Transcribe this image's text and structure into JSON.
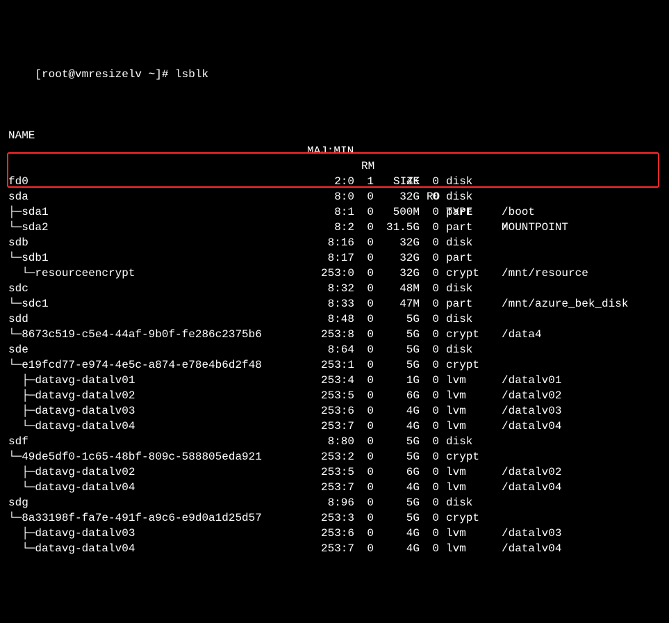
{
  "prompt": "[root@vmresizelv ~]# lsblk",
  "headers": {
    "name": "NAME",
    "majmin": "MAJ:MIN",
    "rm": "RM",
    "size": "SIZE",
    "ro": "RO",
    "type": "TYPE",
    "mount": "MOUNTPOINT"
  },
  "rows": [
    {
      "name": "fd0",
      "majmin": "2:0",
      "rm": "1",
      "size": "4K",
      "ro": "0",
      "type": "disk",
      "mount": ""
    },
    {
      "name": "sda",
      "majmin": "8:0",
      "rm": "0",
      "size": "32G",
      "ro": "0",
      "type": "disk",
      "mount": ""
    },
    {
      "name": "├─sda1",
      "majmin": "8:1",
      "rm": "0",
      "size": "500M",
      "ro": "0",
      "type": "part",
      "mount": "/boot"
    },
    {
      "name": "└─sda2",
      "majmin": "8:2",
      "rm": "0",
      "size": "31.5G",
      "ro": "0",
      "type": "part",
      "mount": "/"
    },
    {
      "name": "sdb",
      "majmin": "8:16",
      "rm": "0",
      "size": "32G",
      "ro": "0",
      "type": "disk",
      "mount": ""
    },
    {
      "name": "└─sdb1",
      "majmin": "8:17",
      "rm": "0",
      "size": "32G",
      "ro": "0",
      "type": "part",
      "mount": ""
    },
    {
      "name": "  └─resourceencrypt",
      "majmin": "253:0",
      "rm": "0",
      "size": "32G",
      "ro": "0",
      "type": "crypt",
      "mount": "/mnt/resource"
    },
    {
      "name": "sdc",
      "majmin": "8:32",
      "rm": "0",
      "size": "48M",
      "ro": "0",
      "type": "disk",
      "mount": ""
    },
    {
      "name": "└─sdc1",
      "majmin": "8:33",
      "rm": "0",
      "size": "47M",
      "ro": "0",
      "type": "part",
      "mount": "/mnt/azure_bek_disk"
    },
    {
      "name": "sdd",
      "majmin": "8:48",
      "rm": "0",
      "size": "5G",
      "ro": "0",
      "type": "disk",
      "mount": ""
    },
    {
      "name": "└─8673c519-c5e4-44af-9b0f-fe286c2375b6",
      "majmin": "253:8",
      "rm": "0",
      "size": "5G",
      "ro": "0",
      "type": "crypt",
      "mount": "/data4"
    },
    {
      "name": "sde",
      "majmin": "8:64",
      "rm": "0",
      "size": "5G",
      "ro": "0",
      "type": "disk",
      "mount": ""
    },
    {
      "name": "└─e19fcd77-e974-4e5c-a874-e78e4b6d2f48",
      "majmin": "253:1",
      "rm": "0",
      "size": "5G",
      "ro": "0",
      "type": "crypt",
      "mount": ""
    },
    {
      "name": "  ├─datavg-datalv01",
      "majmin": "253:4",
      "rm": "0",
      "size": "1G",
      "ro": "0",
      "type": "lvm",
      "mount": "/datalv01"
    },
    {
      "name": "  ├─datavg-datalv02",
      "majmin": "253:5",
      "rm": "0",
      "size": "6G",
      "ro": "0",
      "type": "lvm",
      "mount": "/datalv02"
    },
    {
      "name": "  ├─datavg-datalv03",
      "majmin": "253:6",
      "rm": "0",
      "size": "4G",
      "ro": "0",
      "type": "lvm",
      "mount": "/datalv03"
    },
    {
      "name": "  └─datavg-datalv04",
      "majmin": "253:7",
      "rm": "0",
      "size": "4G",
      "ro": "0",
      "type": "lvm",
      "mount": "/datalv04"
    },
    {
      "name": "sdf",
      "majmin": "8:80",
      "rm": "0",
      "size": "5G",
      "ro": "0",
      "type": "disk",
      "mount": ""
    },
    {
      "name": "└─49de5df0-1c65-48bf-809c-588805eda921",
      "majmin": "253:2",
      "rm": "0",
      "size": "5G",
      "ro": "0",
      "type": "crypt",
      "mount": ""
    },
    {
      "name": "  ├─datavg-datalv02",
      "majmin": "253:5",
      "rm": "0",
      "size": "6G",
      "ro": "0",
      "type": "lvm",
      "mount": "/datalv02"
    },
    {
      "name": "  └─datavg-datalv04",
      "majmin": "253:7",
      "rm": "0",
      "size": "4G",
      "ro": "0",
      "type": "lvm",
      "mount": "/datalv04"
    },
    {
      "name": "sdg",
      "majmin": "8:96",
      "rm": "0",
      "size": "5G",
      "ro": "0",
      "type": "disk",
      "mount": ""
    },
    {
      "name": "└─8a33198f-fa7e-491f-a9c6-e9d0a1d25d57",
      "majmin": "253:3",
      "rm": "0",
      "size": "5G",
      "ro": "0",
      "type": "crypt",
      "mount": ""
    },
    {
      "name": "  ├─datavg-datalv03",
      "majmin": "253:6",
      "rm": "0",
      "size": "4G",
      "ro": "0",
      "type": "lvm",
      "mount": "/datalv03"
    },
    {
      "name": "  └─datavg-datalv04",
      "majmin": "253:7",
      "rm": "0",
      "size": "4G",
      "ro": "0",
      "type": "lvm",
      "mount": "/datalv04"
    }
  ]
}
